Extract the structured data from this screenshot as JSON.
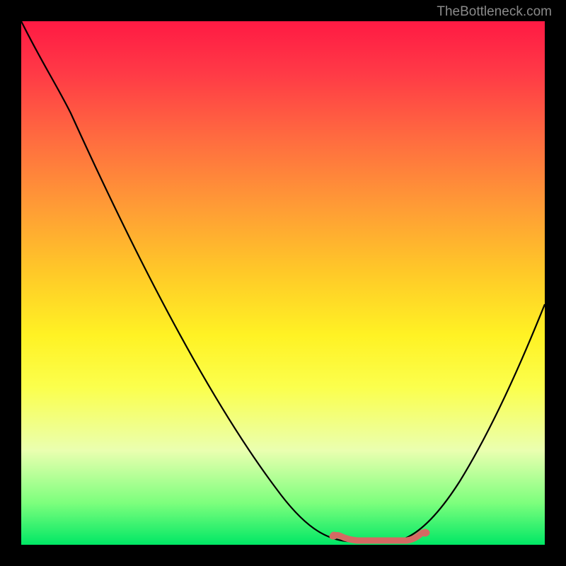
{
  "watermark": "TheBottleneck.com",
  "colors": {
    "background": "#000000",
    "curve": "#000000",
    "highlight": "#d46a63",
    "gradient_top": "#ff1a44",
    "gradient_bottom": "#00e765"
  },
  "chart_data": {
    "type": "line",
    "title": "",
    "xlabel": "",
    "ylabel": "",
    "xlim": [
      0,
      100
    ],
    "ylim": [
      0,
      100
    ],
    "series": [
      {
        "name": "bottleneck-curve",
        "x": [
          0,
          5,
          10,
          15,
          20,
          25,
          30,
          35,
          40,
          45,
          50,
          55,
          60,
          63,
          66,
          70,
          73,
          76,
          80,
          85,
          90,
          95,
          100
        ],
        "y": [
          100,
          94,
          87,
          79,
          71,
          63,
          55,
          47,
          39,
          31,
          23,
          15,
          8,
          4,
          2,
          1,
          1,
          2,
          5,
          12,
          22,
          34,
          48
        ]
      }
    ],
    "highlight_region": {
      "name": "optimal-range",
      "x_start": 60,
      "x_end": 76,
      "color": "#d46a63",
      "description": "flat valley region near minimum"
    },
    "annotations": []
  }
}
